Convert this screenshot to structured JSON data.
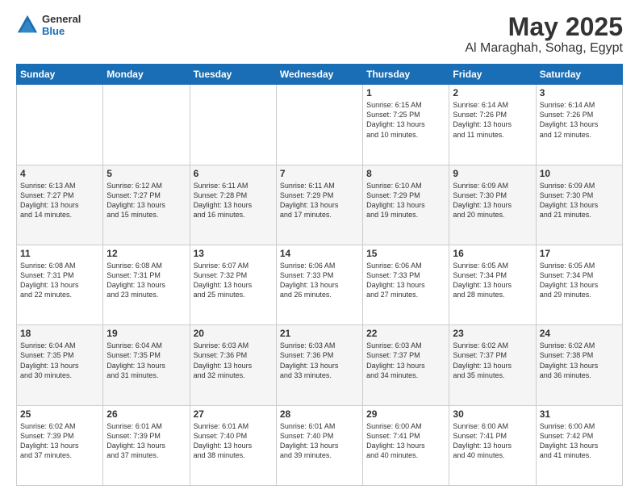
{
  "logo": {
    "line1": "General",
    "line2": "Blue"
  },
  "title": "May 2025",
  "subtitle": "Al Maraghah, Sohag, Egypt",
  "days_header": [
    "Sunday",
    "Monday",
    "Tuesday",
    "Wednesday",
    "Thursday",
    "Friday",
    "Saturday"
  ],
  "weeks": [
    [
      {
        "day": "",
        "info": ""
      },
      {
        "day": "",
        "info": ""
      },
      {
        "day": "",
        "info": ""
      },
      {
        "day": "",
        "info": ""
      },
      {
        "day": "1",
        "info": "Sunrise: 6:15 AM\nSunset: 7:25 PM\nDaylight: 13 hours\nand 10 minutes."
      },
      {
        "day": "2",
        "info": "Sunrise: 6:14 AM\nSunset: 7:26 PM\nDaylight: 13 hours\nand 11 minutes."
      },
      {
        "day": "3",
        "info": "Sunrise: 6:14 AM\nSunset: 7:26 PM\nDaylight: 13 hours\nand 12 minutes."
      }
    ],
    [
      {
        "day": "4",
        "info": "Sunrise: 6:13 AM\nSunset: 7:27 PM\nDaylight: 13 hours\nand 14 minutes."
      },
      {
        "day": "5",
        "info": "Sunrise: 6:12 AM\nSunset: 7:27 PM\nDaylight: 13 hours\nand 15 minutes."
      },
      {
        "day": "6",
        "info": "Sunrise: 6:11 AM\nSunset: 7:28 PM\nDaylight: 13 hours\nand 16 minutes."
      },
      {
        "day": "7",
        "info": "Sunrise: 6:11 AM\nSunset: 7:29 PM\nDaylight: 13 hours\nand 17 minutes."
      },
      {
        "day": "8",
        "info": "Sunrise: 6:10 AM\nSunset: 7:29 PM\nDaylight: 13 hours\nand 19 minutes."
      },
      {
        "day": "9",
        "info": "Sunrise: 6:09 AM\nSunset: 7:30 PM\nDaylight: 13 hours\nand 20 minutes."
      },
      {
        "day": "10",
        "info": "Sunrise: 6:09 AM\nSunset: 7:30 PM\nDaylight: 13 hours\nand 21 minutes."
      }
    ],
    [
      {
        "day": "11",
        "info": "Sunrise: 6:08 AM\nSunset: 7:31 PM\nDaylight: 13 hours\nand 22 minutes."
      },
      {
        "day": "12",
        "info": "Sunrise: 6:08 AM\nSunset: 7:31 PM\nDaylight: 13 hours\nand 23 minutes."
      },
      {
        "day": "13",
        "info": "Sunrise: 6:07 AM\nSunset: 7:32 PM\nDaylight: 13 hours\nand 25 minutes."
      },
      {
        "day": "14",
        "info": "Sunrise: 6:06 AM\nSunset: 7:33 PM\nDaylight: 13 hours\nand 26 minutes."
      },
      {
        "day": "15",
        "info": "Sunrise: 6:06 AM\nSunset: 7:33 PM\nDaylight: 13 hours\nand 27 minutes."
      },
      {
        "day": "16",
        "info": "Sunrise: 6:05 AM\nSunset: 7:34 PM\nDaylight: 13 hours\nand 28 minutes."
      },
      {
        "day": "17",
        "info": "Sunrise: 6:05 AM\nSunset: 7:34 PM\nDaylight: 13 hours\nand 29 minutes."
      }
    ],
    [
      {
        "day": "18",
        "info": "Sunrise: 6:04 AM\nSunset: 7:35 PM\nDaylight: 13 hours\nand 30 minutes."
      },
      {
        "day": "19",
        "info": "Sunrise: 6:04 AM\nSunset: 7:35 PM\nDaylight: 13 hours\nand 31 minutes."
      },
      {
        "day": "20",
        "info": "Sunrise: 6:03 AM\nSunset: 7:36 PM\nDaylight: 13 hours\nand 32 minutes."
      },
      {
        "day": "21",
        "info": "Sunrise: 6:03 AM\nSunset: 7:36 PM\nDaylight: 13 hours\nand 33 minutes."
      },
      {
        "day": "22",
        "info": "Sunrise: 6:03 AM\nSunset: 7:37 PM\nDaylight: 13 hours\nand 34 minutes."
      },
      {
        "day": "23",
        "info": "Sunrise: 6:02 AM\nSunset: 7:37 PM\nDaylight: 13 hours\nand 35 minutes."
      },
      {
        "day": "24",
        "info": "Sunrise: 6:02 AM\nSunset: 7:38 PM\nDaylight: 13 hours\nand 36 minutes."
      }
    ],
    [
      {
        "day": "25",
        "info": "Sunrise: 6:02 AM\nSunset: 7:39 PM\nDaylight: 13 hours\nand 37 minutes."
      },
      {
        "day": "26",
        "info": "Sunrise: 6:01 AM\nSunset: 7:39 PM\nDaylight: 13 hours\nand 37 minutes."
      },
      {
        "day": "27",
        "info": "Sunrise: 6:01 AM\nSunset: 7:40 PM\nDaylight: 13 hours\nand 38 minutes."
      },
      {
        "day": "28",
        "info": "Sunrise: 6:01 AM\nSunset: 7:40 PM\nDaylight: 13 hours\nand 39 minutes."
      },
      {
        "day": "29",
        "info": "Sunrise: 6:00 AM\nSunset: 7:41 PM\nDaylight: 13 hours\nand 40 minutes."
      },
      {
        "day": "30",
        "info": "Sunrise: 6:00 AM\nSunset: 7:41 PM\nDaylight: 13 hours\nand 40 minutes."
      },
      {
        "day": "31",
        "info": "Sunrise: 6:00 AM\nSunset: 7:42 PM\nDaylight: 13 hours\nand 41 minutes."
      }
    ]
  ]
}
